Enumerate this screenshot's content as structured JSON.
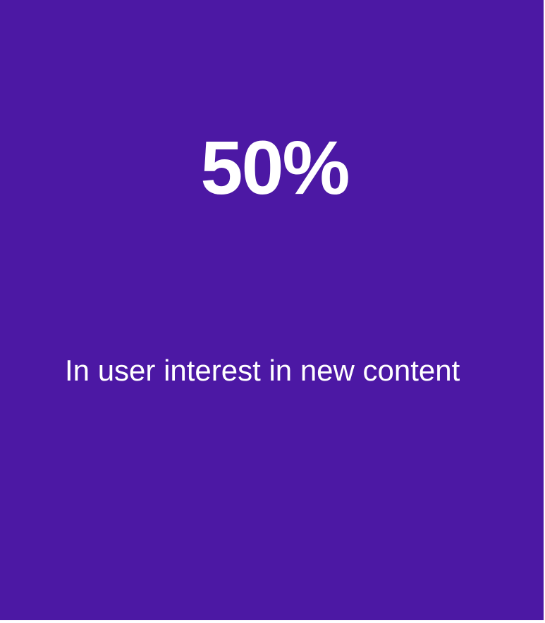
{
  "stat": {
    "value": "50%",
    "caption": "In user interest in new content"
  },
  "colors": {
    "background": "#4c18a4",
    "text": "#ffffff"
  }
}
